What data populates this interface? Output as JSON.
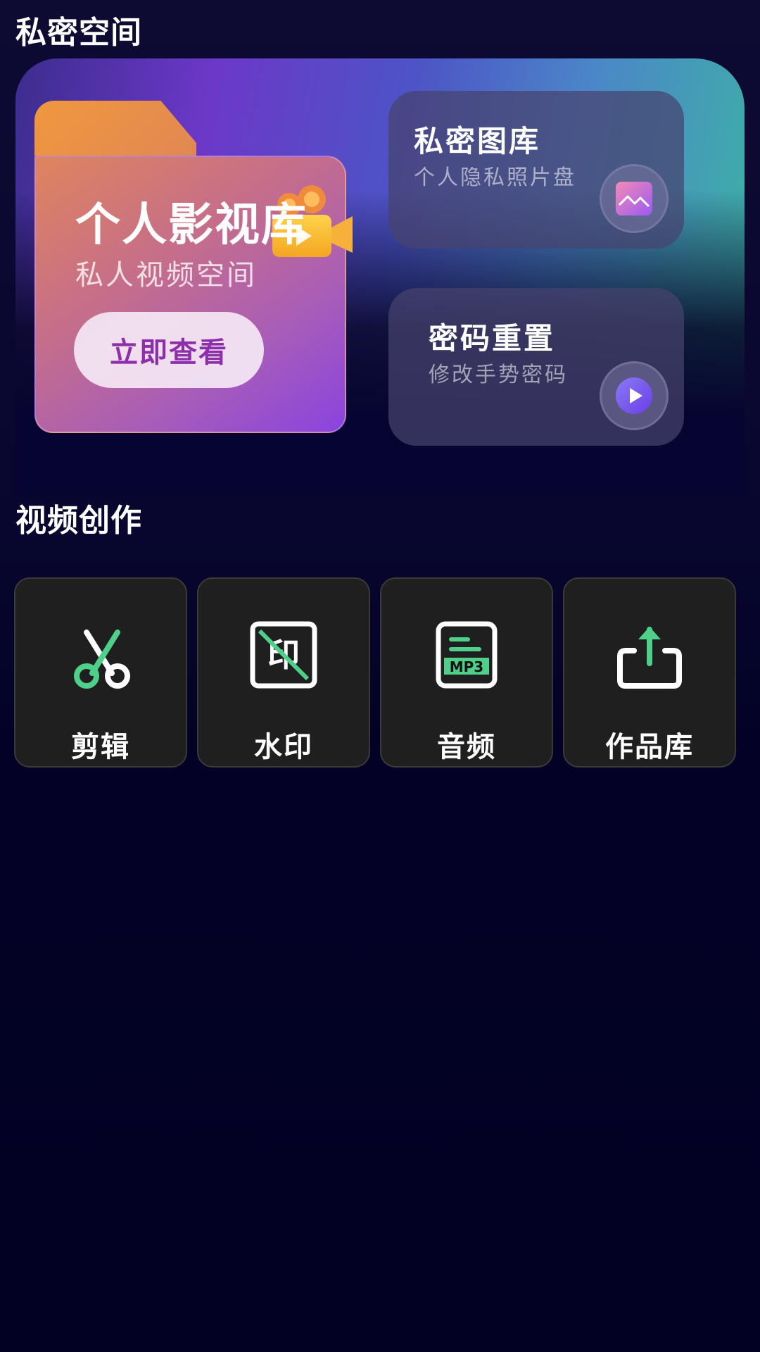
{
  "private_space": {
    "section_title": "私密空间",
    "library_card": {
      "title": "个人影视库",
      "subtitle": "私人视频空间",
      "button_label": "立即查看"
    },
    "gallery_card": {
      "title": "私密图库",
      "subtitle": "个人隐私照片盘",
      "icon": "image-gallery-icon"
    },
    "reset_card": {
      "title": "密码重置",
      "subtitle": "修改手势密码",
      "icon": "play-icon"
    }
  },
  "video_creation": {
    "section_title": "视频创作",
    "tools": [
      {
        "label": "剪辑",
        "icon": "scissors-icon"
      },
      {
        "label": "水印",
        "icon": "watermark-icon"
      },
      {
        "label": "音频",
        "icon": "mp3-file-icon"
      },
      {
        "label": "作品库",
        "icon": "share-upload-icon"
      }
    ]
  },
  "colors": {
    "background": "#03021f",
    "accent_green": "#4fd08a",
    "accent_purple": "#8c2fa8",
    "tile_background": "#1f1f1f"
  }
}
